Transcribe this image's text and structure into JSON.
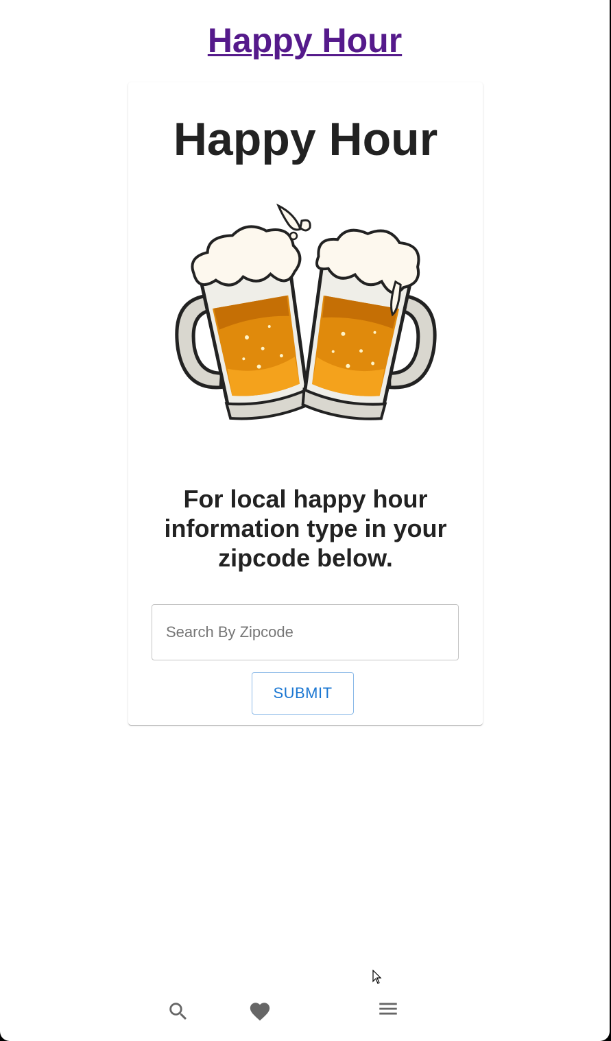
{
  "header": {
    "title_link": "Happy Hour"
  },
  "card": {
    "title": "Happy Hour",
    "image_name": "beer-mugs-cheers-illustration",
    "prompt": "For local happy hour information type in your zipcode below.",
    "search": {
      "placeholder": "Search By Zipcode",
      "value": ""
    },
    "submit_label": "SUBMIT"
  },
  "bottom_nav": {
    "items": [
      {
        "icon": "search-icon"
      },
      {
        "icon": "heart-icon"
      },
      {
        "icon": "menu-icon"
      }
    ]
  },
  "colors": {
    "link": "#551a8b",
    "primary": "#1976d2",
    "text": "#222222",
    "icon": "#666666",
    "beer": "#e08a0c",
    "foam": "#fdf8ee"
  }
}
